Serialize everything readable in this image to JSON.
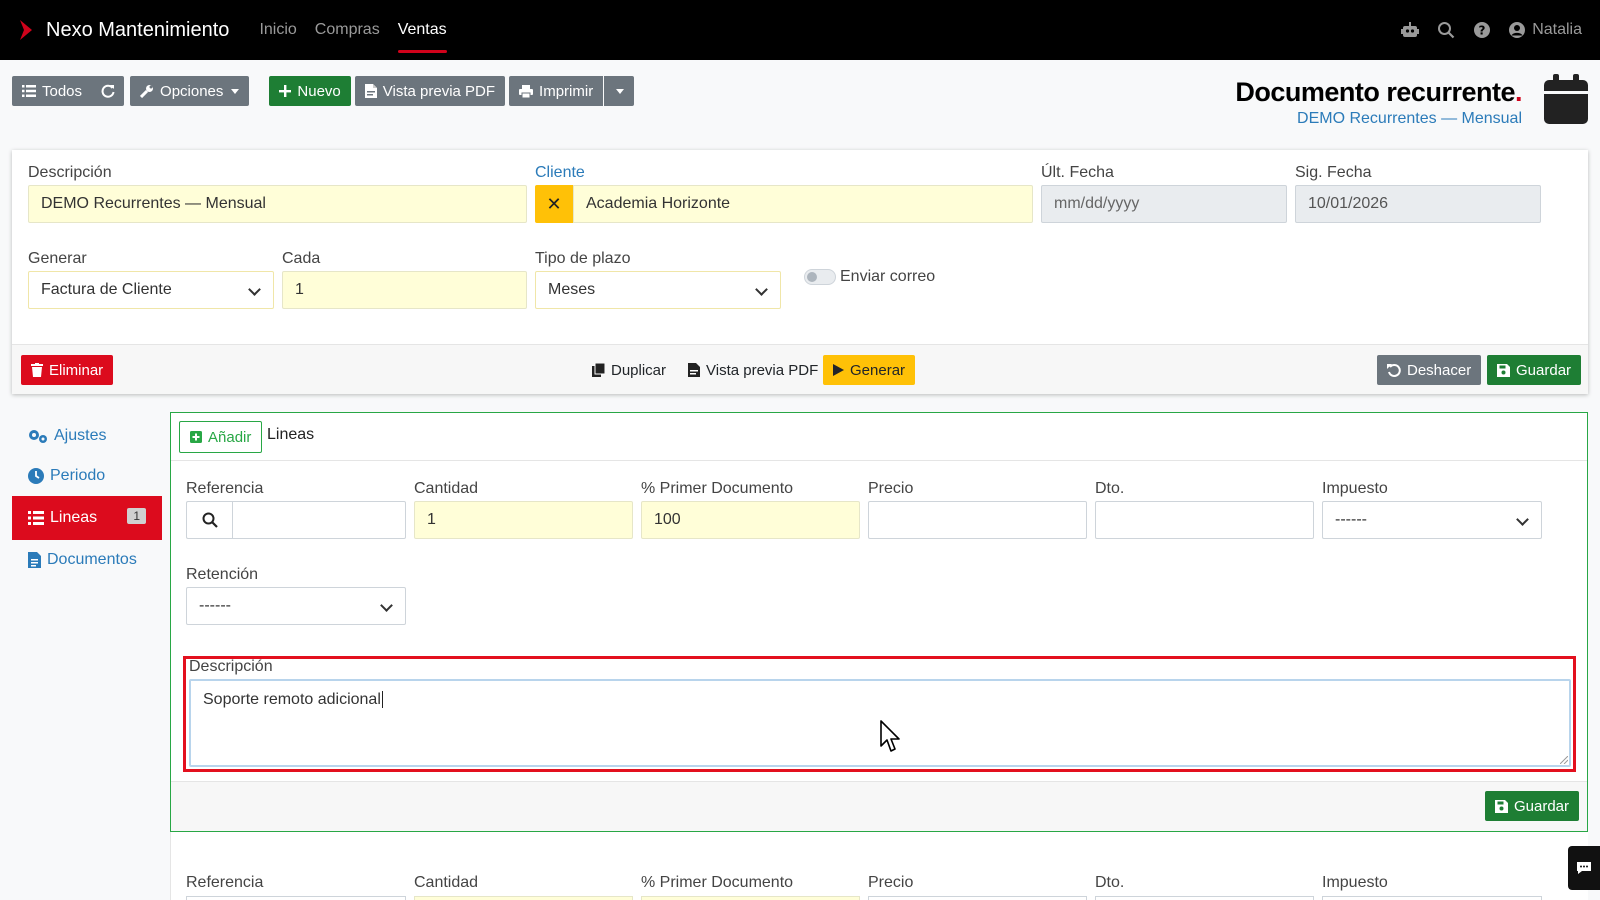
{
  "navbar": {
    "brand": "Nexo Mantenimiento",
    "links": [
      "Inicio",
      "Compras",
      "Ventas"
    ],
    "active_link": "Ventas",
    "user": "Natalia",
    "icons": [
      "robot-icon",
      "search-icon",
      "help-icon",
      "user-icon"
    ]
  },
  "toolbar": {
    "all_label": "Todos",
    "options_label": "Opciones",
    "new_label": "Nuevo",
    "pdf_preview_label": "Vista previa PDF",
    "print_label": "Imprimir"
  },
  "header": {
    "title": "Documento recurrente",
    "title_dot": ".",
    "subtitle": "DEMO Recurrentes — Mensual"
  },
  "form": {
    "descripcion_label": "Descripción",
    "descripcion_value": "DEMO Recurrentes — Mensual",
    "cliente_label": "Cliente",
    "cliente_value": "Academia Horizonte",
    "ult_fecha_label": "Últ. Fecha",
    "ult_fecha_placeholder": "mm/dd/yyyy",
    "sig_fecha_label": "Sig. Fecha",
    "sig_fecha_value": "10/01/2026",
    "generar_label": "Generar",
    "generar_value": "Factura de Cliente",
    "cada_label": "Cada",
    "cada_value": "1",
    "tipo_plazo_label": "Tipo de plazo",
    "tipo_plazo_value": "Meses",
    "enviar_correo_label": "Enviar correo"
  },
  "form_footer": {
    "delete_label": "Eliminar",
    "duplicate_label": "Duplicar",
    "pdf_preview_label": "Vista previa PDF",
    "generate_label": "Generar",
    "undo_label": "Deshacer",
    "save_label": "Guardar"
  },
  "sidebar": {
    "items": [
      {
        "label": "Ajustes",
        "icon": "gears-icon"
      },
      {
        "label": "Periodo",
        "icon": "clock-icon"
      },
      {
        "label": "Lineas",
        "icon": "list-icon",
        "badge": "1",
        "active": true
      },
      {
        "label": "Documentos",
        "icon": "file-icon"
      }
    ]
  },
  "lines": {
    "add_label": "Añadir",
    "tab_label": "Lineas",
    "referencia_label": "Referencia",
    "cantidad_label": "Cantidad",
    "cantidad_value": "1",
    "primer_doc_label": "% Primer Documento",
    "primer_doc_value": "100",
    "precio_label": "Precio",
    "dto_label": "Dto.",
    "impuesto_label": "Impuesto",
    "impuesto_value": "------",
    "retencion_label": "Retención",
    "retencion_value": "------",
    "descripcion_label": "Descripción",
    "descripcion_value": "Soporte remoto adicional",
    "save_label": "Guardar"
  },
  "next_line": {
    "referencia_label": "Referencia",
    "cantidad_label": "Cantidad",
    "primer_doc_label": "% Primer Documento",
    "precio_label": "Precio",
    "dto_label": "Dto.",
    "impuesto_label": "Impuesto"
  },
  "colors": {
    "brand_red": "#d0021b",
    "success": "#1e7e34",
    "danger": "#dc0b1d",
    "warning": "#ffc107",
    "link": "#2b7bb9",
    "input_yellow": "#fffed8"
  }
}
